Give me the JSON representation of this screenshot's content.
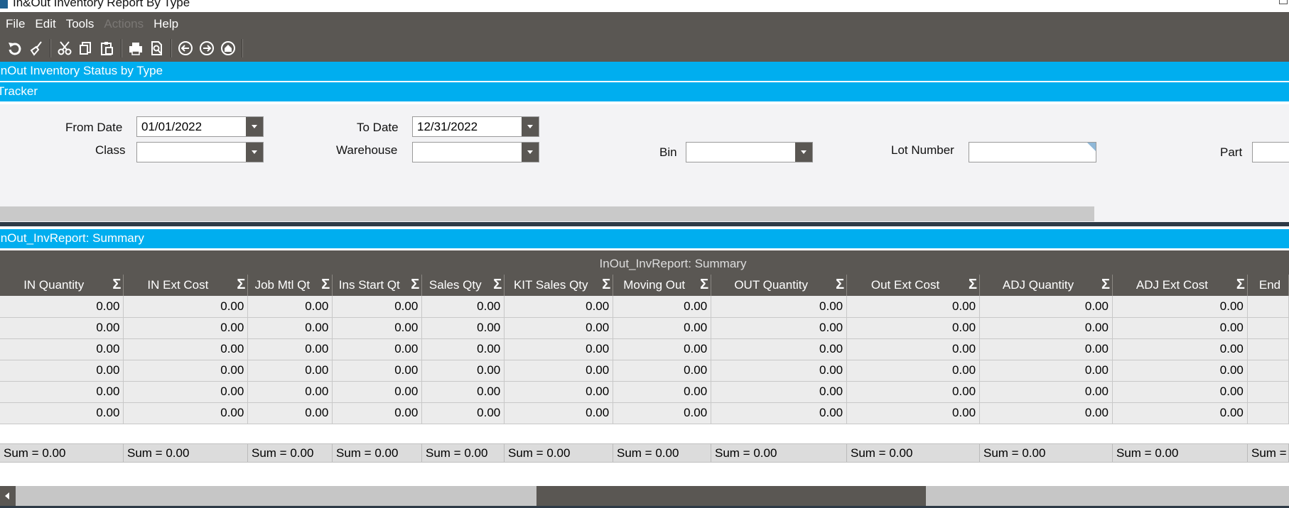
{
  "window": {
    "title": "In&Out Inventory Report By Type"
  },
  "menu": {
    "items": [
      "File",
      "Edit",
      "Tools",
      "Actions",
      "Help"
    ],
    "disabled": [
      "Actions"
    ]
  },
  "toolbar": {
    "icons": [
      "refresh-icon",
      "clear-icon",
      "cut-icon",
      "copy-icon",
      "paste-icon",
      "print-icon",
      "print-preview-icon",
      "back-icon",
      "forward-icon",
      "home-icon"
    ]
  },
  "bands": {
    "status": "InOut Inventory Status by Type",
    "tracker": "Tracker",
    "summary": "InOut_InvReport: Summary"
  },
  "filters": {
    "from_date_label": "From Date",
    "from_date_value": "01/01/2022",
    "to_date_label": "To Date",
    "to_date_value": "12/31/2022",
    "class_label": "Class",
    "class_value": "",
    "warehouse_label": "Warehouse",
    "warehouse_value": "",
    "bin_label": "Bin",
    "bin_value": "",
    "lot_label": "Lot Number",
    "lot_value": "",
    "part_label": "Part",
    "part_value": ""
  },
  "grid": {
    "title": "InOut_InvReport: Summary",
    "columns": [
      "IN Quantity",
      "IN Ext Cost",
      "Job Mtl Qt",
      "Ins Start Qt",
      "Sales Qty",
      "KIT Sales Qty",
      "Moving Out",
      "OUT Quantity",
      "Out Ext Cost",
      "ADJ Quantity",
      "ADJ Ext Cost",
      "End"
    ],
    "rows": [
      [
        "0.00",
        "0.00",
        "0.00",
        "0.00",
        "0.00",
        "0.00",
        "0.00",
        "0.00",
        "0.00",
        "0.00",
        "0.00",
        ""
      ],
      [
        "0.00",
        "0.00",
        "0.00",
        "0.00",
        "0.00",
        "0.00",
        "0.00",
        "0.00",
        "0.00",
        "0.00",
        "0.00",
        ""
      ],
      [
        "0.00",
        "0.00",
        "0.00",
        "0.00",
        "0.00",
        "0.00",
        "0.00",
        "0.00",
        "0.00",
        "0.00",
        "0.00",
        ""
      ],
      [
        "0.00",
        "0.00",
        "0.00",
        "0.00",
        "0.00",
        "0.00",
        "0.00",
        "0.00",
        "0.00",
        "0.00",
        "0.00",
        ""
      ],
      [
        "0.00",
        "0.00",
        "0.00",
        "0.00",
        "0.00",
        "0.00",
        "0.00",
        "0.00",
        "0.00",
        "0.00",
        "0.00",
        ""
      ],
      [
        "0.00",
        "0.00",
        "0.00",
        "0.00",
        "0.00",
        "0.00",
        "0.00",
        "0.00",
        "0.00",
        "0.00",
        "0.00",
        ""
      ]
    ],
    "sums": [
      "Sum = 0.00",
      "Sum = 0.00",
      "Sum = 0.00",
      "Sum = 0.00",
      "Sum = 0.00",
      "Sum = 0.00",
      "Sum = 0.00",
      "Sum = 0.00",
      "Sum = 0.00",
      "Sum = 0.00",
      "Sum = 0.00",
      "Sum ="
    ]
  },
  "colors": {
    "band": "#00aeef",
    "chrome": "#5a5753"
  }
}
